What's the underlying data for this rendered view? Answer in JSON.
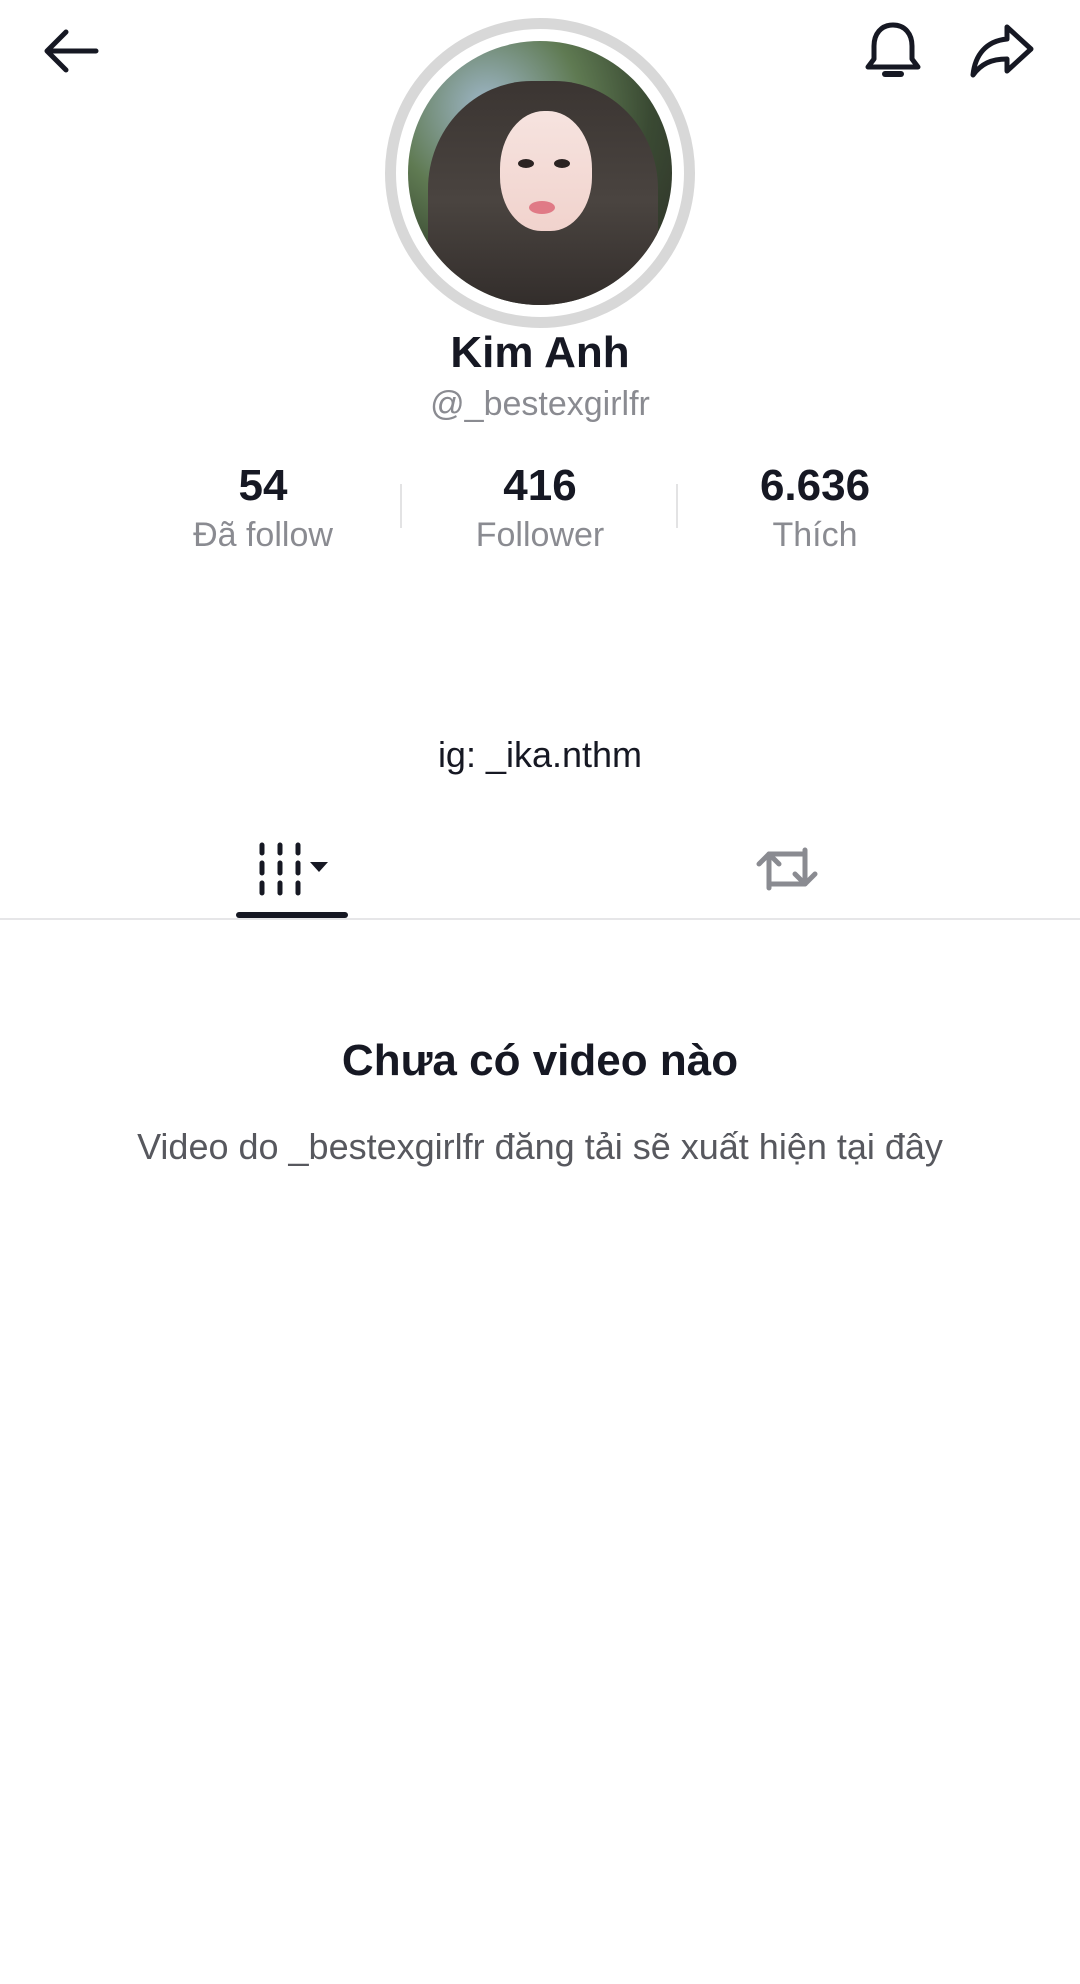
{
  "header": {
    "back_icon": "arrow-left-icon",
    "notification_icon": "bell-icon",
    "share_icon": "share-arrow-icon"
  },
  "profile": {
    "display_name": "Kim Anh",
    "username": "@_bestexgirlfr",
    "bio": "ig: _ika.nthm"
  },
  "stats": {
    "following": {
      "value": "54",
      "label": "Đã follow"
    },
    "followers": {
      "value": "416",
      "label": "Follower"
    },
    "likes": {
      "value": "6.636",
      "label": "Thích"
    }
  },
  "tabs": [
    {
      "name": "videos",
      "icon": "grid-bars-dropdown-icon",
      "active": true
    },
    {
      "name": "reposts",
      "icon": "repost-icon",
      "active": false
    }
  ],
  "empty_state": {
    "title": "Chưa có video nào",
    "subtitle": "Video do _bestexgirlfr đăng tải sẽ xuất hiện tại đây"
  },
  "colors": {
    "text_primary": "#161823",
    "text_secondary": "#8a8b91",
    "avatar_ring": "#d8d8d8",
    "divider": "#e6e6e8"
  }
}
